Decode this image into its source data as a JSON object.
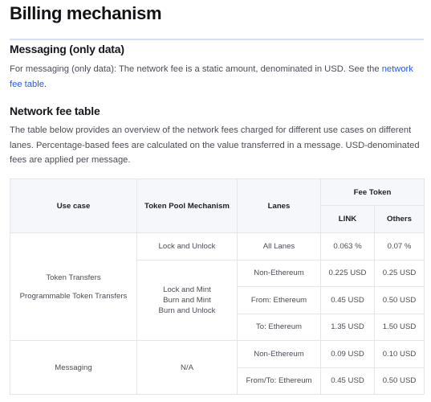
{
  "page_title": "Billing mechanism",
  "section_messaging": {
    "heading": "Messaging (only data)",
    "text_before_link": "For messaging (only data): The network fee is a static amount, denominated in USD. See the ",
    "link_text": "network fee table",
    "text_after_link": ".",
    "link_color": "#2a5ada"
  },
  "section_fee_table": {
    "heading": "Network fee table",
    "description": "The table below provides an overview of the network fees charged for different use cases on different lanes. Percentage-based fees are calculated on the value transferred in a message. USD-denominated fees are applied per message."
  },
  "table": {
    "headers": {
      "use_case": "Use case",
      "mechanism": "Token Pool Mechanism",
      "lanes": "Lanes",
      "fee_token": "Fee Token",
      "link": "LINK",
      "others": "Others"
    },
    "groups": [
      {
        "use_case_lines": [
          "Token Transfers",
          "Programmable Token Transfers"
        ],
        "mechanisms": [
          {
            "label_lines": [
              "Lock and Unlock"
            ],
            "rows": [
              {
                "lane": "All Lanes",
                "link": "0.063 %",
                "others": "0.07 %"
              }
            ]
          },
          {
            "label_lines": [
              "Lock and Mint",
              "Burn and Mint",
              "Burn and Unlock"
            ],
            "rows": [
              {
                "lane": "Non-Ethereum",
                "link": "0.225 USD",
                "others": "0.25 USD"
              },
              {
                "lane": "From: Ethereum",
                "link": "0.45 USD",
                "others": "0.50 USD"
              },
              {
                "lane": "To: Ethereum",
                "link": "1.35 USD",
                "others": "1.50 USD"
              }
            ]
          }
        ]
      },
      {
        "use_case_lines": [
          "Messaging"
        ],
        "mechanisms": [
          {
            "label_lines": [
              "N/A"
            ],
            "rows": [
              {
                "lane": "Non-Ethereum",
                "link": "0.09 USD",
                "others": "0.10 USD"
              },
              {
                "lane": "From/To: Ethereum",
                "link": "0.45 USD",
                "others": "0.50 USD"
              }
            ]
          }
        ]
      }
    ]
  }
}
